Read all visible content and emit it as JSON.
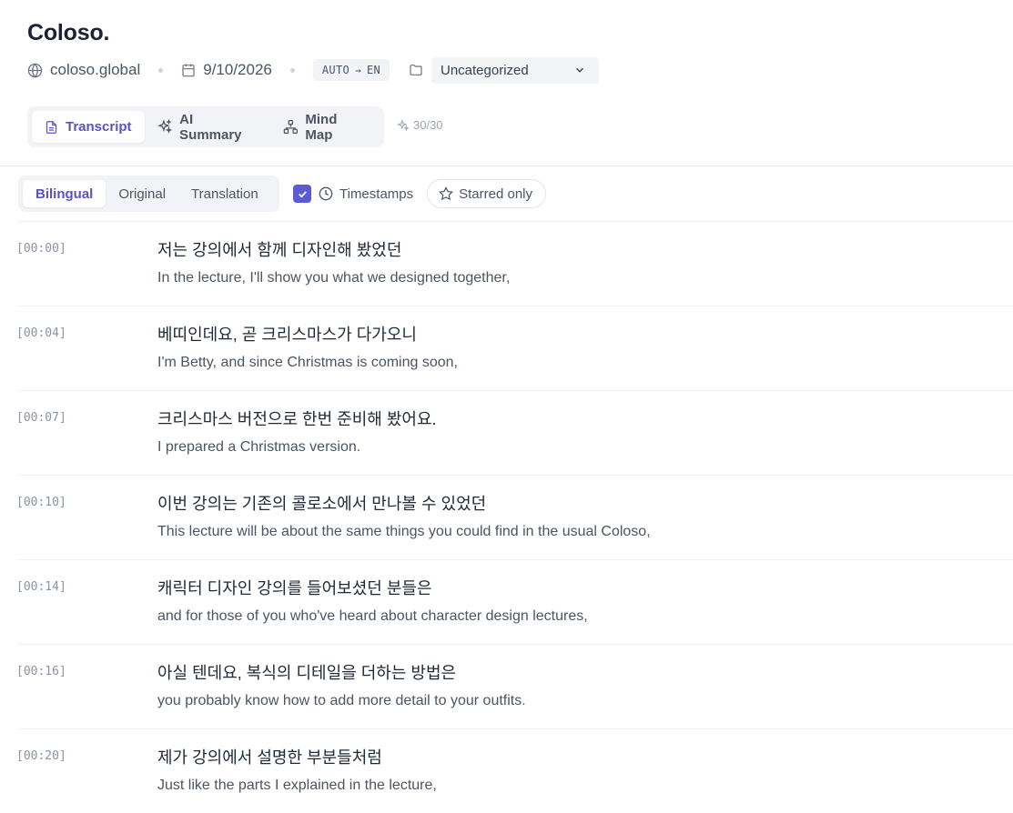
{
  "header": {
    "title": "Coloso.",
    "site": "coloso.global",
    "date": "9/10/2026",
    "lang_from": "AUTO",
    "lang_arrow": "→",
    "lang_to": "EN",
    "folder_value": "Uncategorized"
  },
  "tabs": [
    {
      "label": "Transcript",
      "active": true
    },
    {
      "label": "AI Summary",
      "active": false
    },
    {
      "label": "Mind Map",
      "active": false
    }
  ],
  "quota": "30/30",
  "toolbar": {
    "modes": [
      {
        "label": "Bilingual",
        "active": true
      },
      {
        "label": "Original",
        "active": false
      },
      {
        "label": "Translation",
        "active": false
      }
    ],
    "timestamps_label": "Timestamps",
    "timestamps_checked": true,
    "starred_label": "Starred only"
  },
  "accent_color": "#5b52c9",
  "transcript": [
    {
      "time": "[00:00]",
      "original": "저는 강의에서 함께 디자인해 봤었던",
      "translation": "In the lecture, I'll show you what we designed together,"
    },
    {
      "time": "[00:04]",
      "original": "베띠인데요, 곧 크리스마스가 다가오니",
      "translation": "I'm Betty, and since Christmas is coming soon,"
    },
    {
      "time": "[00:07]",
      "original": "크리스마스 버전으로 한번 준비해 봤어요.",
      "translation": "I prepared a Christmas version."
    },
    {
      "time": "[00:10]",
      "original": "이번 강의는 기존의 콜로소에서 만나볼 수 있었던",
      "translation": "This lecture will be about the same things you could find in the usual Coloso,"
    },
    {
      "time": "[00:14]",
      "original": "캐릭터 디자인 강의를 들어보셨던 분들은",
      "translation": "and for those of you who've heard about character design lectures,"
    },
    {
      "time": "[00:16]",
      "original": "아실 텐데요, 복식의 디테일을 더하는 방법은",
      "translation": "you probably know how to add more detail to your outfits."
    },
    {
      "time": "[00:20]",
      "original": "제가 강의에서 설명한 부분들처럼",
      "translation": "Just like the parts I explained in the lecture,"
    }
  ]
}
